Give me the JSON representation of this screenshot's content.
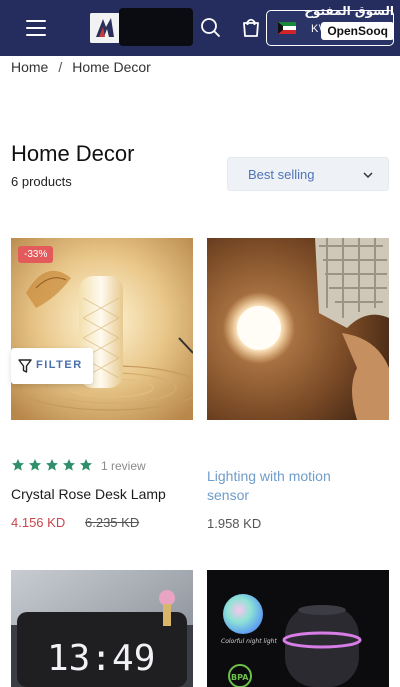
{
  "header": {
    "country_code": "KW",
    "watermark_arabic": "السوق المفتوح",
    "watermark_latin": "OpenSooq"
  },
  "breadcrumb": {
    "home": "Home",
    "separator": "/",
    "current": "Home Decor"
  },
  "collection": {
    "title": "Home Decor",
    "count_label": "6 products",
    "sort_label": "Best selling"
  },
  "filter": {
    "label": "FILTER"
  },
  "products": [
    {
      "badge": "-33%",
      "rating_stars": 5,
      "review_label": "1 review",
      "name": "Crystal Rose Desk Lamp",
      "sale_price": "4.156 KD",
      "compare_price": "6.235 KD"
    },
    {
      "name": "Lighting with motion sensor",
      "price": "1.958 KD"
    },
    {
      "image_text": "13:49"
    },
    {
      "image_caption": "Colorful night light",
      "image_badge": "BPA"
    }
  ],
  "colors": {
    "header_bg": "#242d5e",
    "sale_red": "#c9464d",
    "star_green": "#2f8f6b",
    "link_blue": "#6f9cc9",
    "sort_bg": "#eef1f6"
  },
  "icons": [
    "menu-icon",
    "search-icon",
    "cart-icon",
    "kuwait-flag-icon",
    "chevron-down-icon",
    "filter-funnel-icon",
    "star-icon"
  ]
}
